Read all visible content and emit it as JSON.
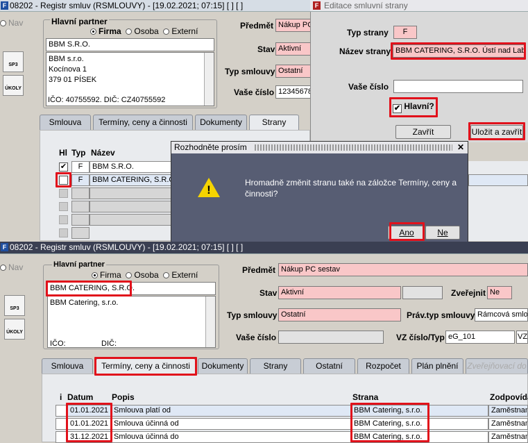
{
  "win1": {
    "title": "08202 - Registr smluv (RSMLOUVY) - [19.02.2021; 07:15]  [ ]  [ ]",
    "nav_label": "Nav",
    "sp3_label": "SP3",
    "ukoly_label": "ÚKOLY",
    "partner_group": "Hlavní partner",
    "radio_firma": "Firma",
    "radio_osoba": "Osoba",
    "radio_externi": "Externí",
    "partner_name": "BBM S.R.O.",
    "partner_address": "BBM s.r.o.\nKocínova 1\n379 01 PÍSEK",
    "ico_dic": "IČO: 40755592. DIČ: CZ40755592",
    "predmet_label": "Předmět",
    "predmet_value": "Nákup PC",
    "stav_label": "Stav",
    "stav_value": "Aktivní",
    "typ_label": "Typ smlouvy",
    "typ_value": "Ostatní",
    "vase_label": "Vaše číslo",
    "vase_value": "12345678",
    "tabs": [
      "Smlouva",
      "Termíny, ceny a činnosti",
      "Dokumenty",
      "Strany"
    ],
    "grid_headers": {
      "hl": "Hl",
      "typ": "Typ",
      "nazev": "Název"
    },
    "grid_rows": [
      {
        "hl": "✔",
        "typ": "F",
        "nazev": "BBM S.R.O."
      },
      {
        "hl": "",
        "typ": "F",
        "nazev": "BBM CATERING, S.R.O."
      }
    ]
  },
  "dialog_edit": {
    "title": "Editace smluvní strany",
    "typ_label": "Typ strany",
    "typ_value": "F",
    "nazev_label": "Název strany",
    "nazev_value": "BBM CATERING, S.R.O. Ústí nad Labe",
    "vase_label": "Vaše číslo",
    "hlavni_label": "Hlavní?",
    "hlavni_checked": "✔",
    "zavrit": "Zavřít",
    "ulozit": "Uložit a zavřít"
  },
  "confirm": {
    "title": "Rozhodněte prosím",
    "message": "Hromadně změnit stranu také na záložce Termíny, ceny a činnosti?",
    "ano": "Ano",
    "ne": "Ne",
    "close": "✕"
  },
  "win2": {
    "title": "08202 - Registr smluv (RSMLOUVY) - [19.02.2021; 07:15]  [ ]  [ ]",
    "nav_label": "Nav",
    "sp3_label": "SP3",
    "ukoly_label": "ÚKOLY",
    "partner_group": "Hlavní partner",
    "radio_firma": "Firma",
    "radio_osoba": "Osoba",
    "radio_externi": "Externí",
    "partner_name": "BBM CATERING, S.R.O.",
    "partner_address": "BBM Catering, s.r.o.",
    "ico_label": "IČO:",
    "dic_label": "DIČ:",
    "predmet_label": "Předmět",
    "predmet_value": "Nákup PC sestav",
    "stav_label": "Stav",
    "stav_value": "Aktivní",
    "zverejnit_label": "Zveřejnit",
    "zverejnit_value": "Ne",
    "typ_label": "Typ smlouvy",
    "typ_value": "Ostatní",
    "prav_label": "Práv.typ smlouvy",
    "prav_value": "Rámcová smlou",
    "vase_label": "Vaše číslo",
    "vz_label": "VZ číslo/Typ",
    "vz_value": "eG_101",
    "vz_type": "VZ",
    "tabs": [
      "Smlouva",
      "Termíny, ceny a činnosti",
      "Dokumenty",
      "Strany",
      "Ostatní",
      "Rozpočet",
      "Plán plnění",
      "Zveřejňovací do"
    ],
    "grid_headers": {
      "i": "i",
      "datum": "Datum",
      "popis": "Popis",
      "strana": "Strana",
      "zodp": "Zodpovídá"
    },
    "grid_rows": [
      {
        "datum": "01.01.2021",
        "popis": "Smlouva platí od",
        "strana": "BBM Catering, s.r.o.",
        "zodp": "Zaměstnan"
      },
      {
        "datum": "01.01.2021",
        "popis": "Smlouva účinná od",
        "strana": "BBM Catering, s.r.o.",
        "zodp": "Zaměstnan"
      },
      {
        "datum": "31.12.2021",
        "popis": "Smlouva účinná do",
        "strana": "BBM Catering, s.r.o.",
        "zodp": "Zaměstnan"
      }
    ]
  }
}
